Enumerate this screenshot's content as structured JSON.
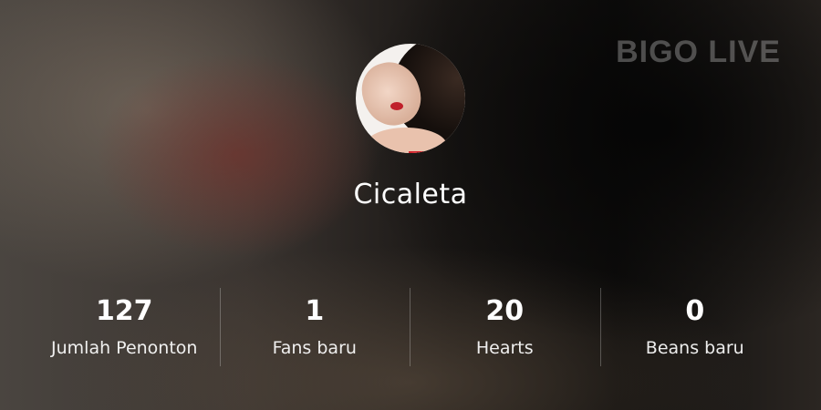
{
  "watermark": "BIGO LIVE",
  "profile": {
    "username": "Cicaleta"
  },
  "stats": [
    {
      "value": "127",
      "label": "Jumlah Penonton"
    },
    {
      "value": "1",
      "label": "Fans baru"
    },
    {
      "value": "20",
      "label": "Hearts"
    },
    {
      "value": "0",
      "label": "Beans baru"
    }
  ]
}
